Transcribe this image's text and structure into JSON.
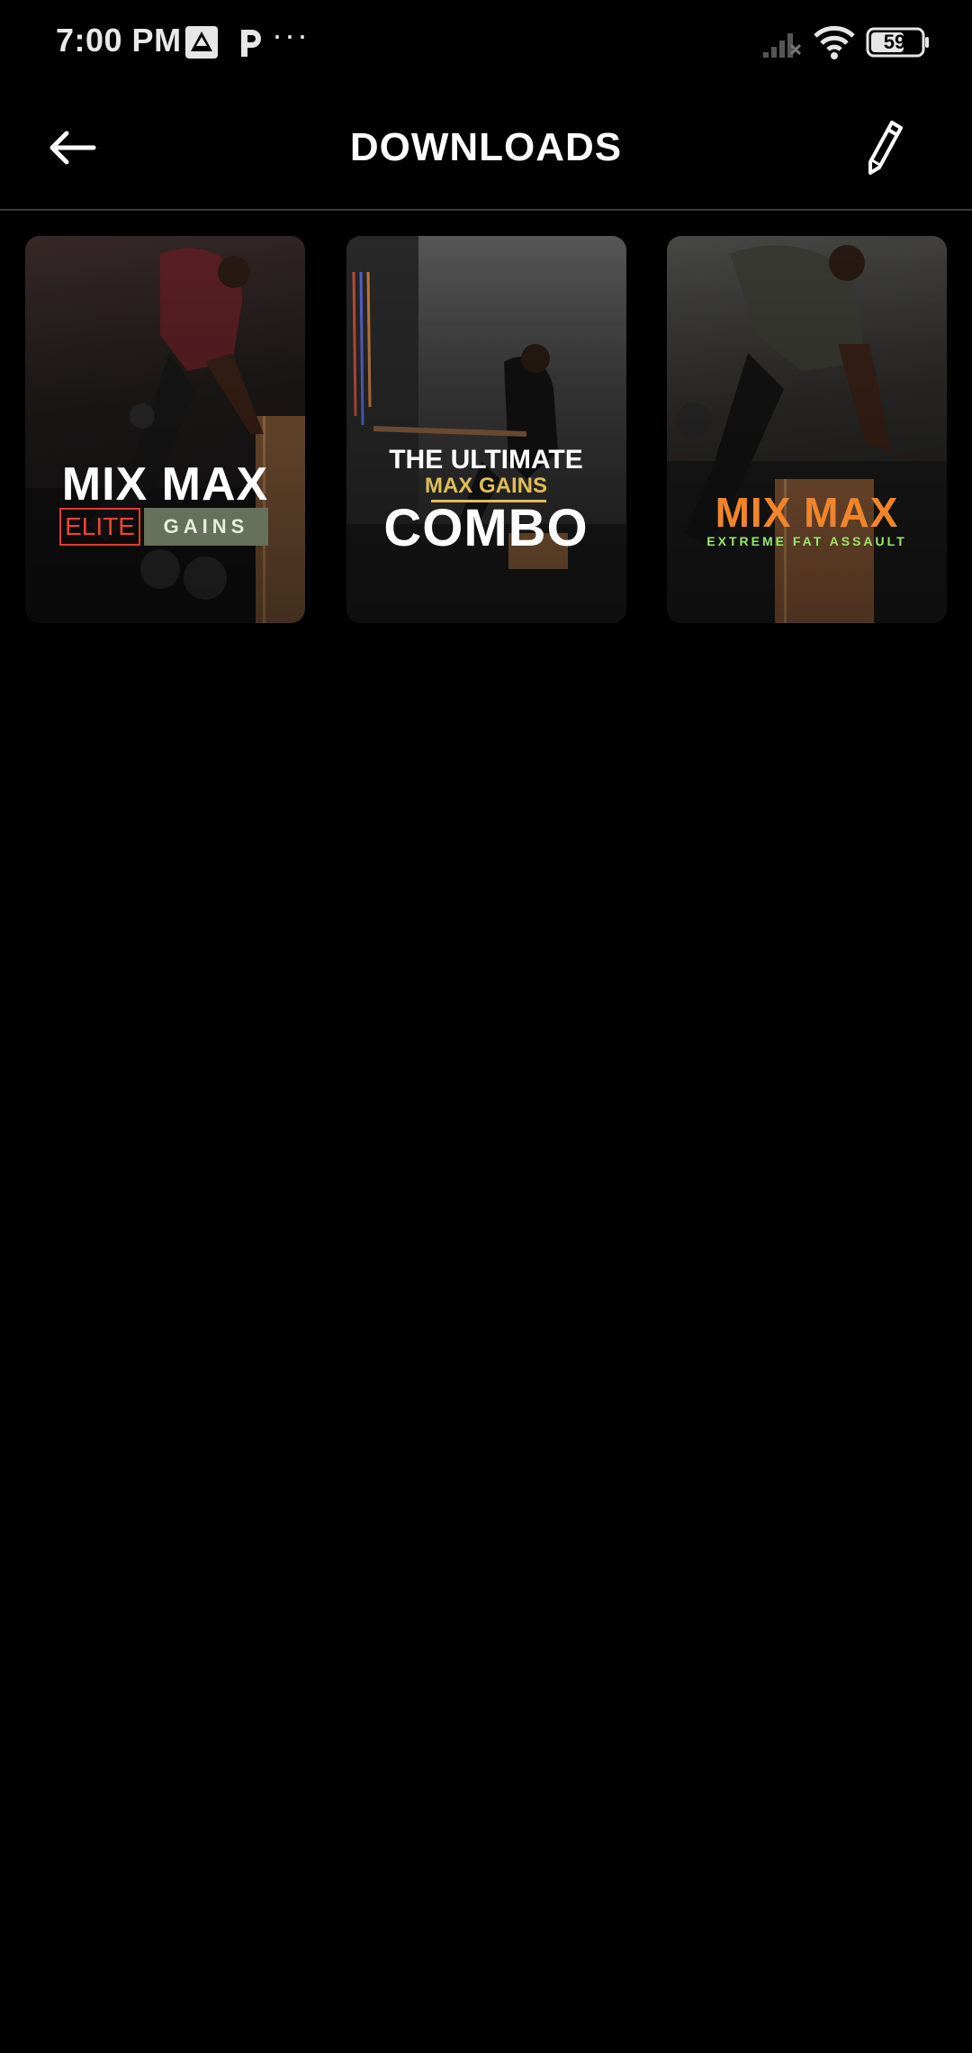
{
  "status_bar": {
    "time": "7:00 PM",
    "more": "···",
    "battery": "59",
    "icons": [
      "app-notification-icon",
      "p-app-icon",
      "signal-icon",
      "wifi-icon",
      "battery-icon"
    ]
  },
  "header": {
    "title": "DOWNLOADS",
    "back_icon": "back-arrow-icon",
    "edit_icon": "pencil-icon"
  },
  "downloads": [
    {
      "title": "MIX MAX",
      "badge_left": "ELITE",
      "badge_right": "GAINS",
      "colors": {
        "title": "#ffffff",
        "badge_left": "#ef4434",
        "badge_right_bg": "#66705a"
      }
    },
    {
      "line1": "THE ULTIMATE",
      "line2": "MAX GAINS",
      "line3": "COMBO",
      "colors": {
        "line2": "#e0bd55"
      }
    },
    {
      "title": "MIX MAX",
      "subtitle": "EXTREME FAT ASSAULT",
      "colors": {
        "title": "#f2852a",
        "subtitle": "#9be86b"
      }
    }
  ]
}
